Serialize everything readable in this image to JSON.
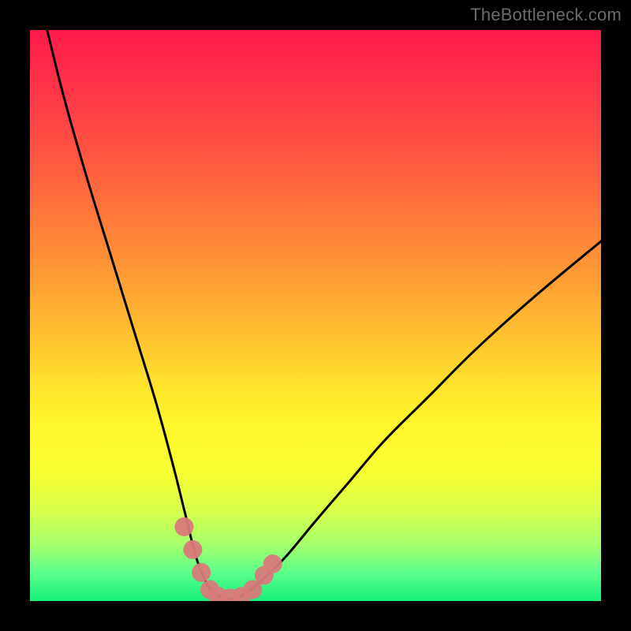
{
  "watermark": "TheBottleneck.com",
  "colors": {
    "background": "#000000",
    "gradient_top": "#ff1a4b",
    "gradient_bottom": "#18f07a",
    "curve": "#000000",
    "marker": "#d87a7a"
  },
  "chart_data": {
    "type": "line",
    "title": "",
    "xlabel": "",
    "ylabel": "",
    "xlim": [
      0,
      100
    ],
    "ylim": [
      0,
      100
    ],
    "grid": false,
    "legend": false,
    "series": [
      {
        "name": "bottleneck-curve",
        "x": [
          3,
          6,
          10,
          14,
          18,
          22,
          25,
          27,
          29,
          30.5,
          32,
          34,
          36,
          38,
          41,
          45,
          50,
          56,
          62,
          70,
          78,
          88,
          100
        ],
        "y": [
          100,
          88,
          74,
          61,
          48,
          35,
          24,
          16,
          8,
          4,
          1.5,
          0.5,
          0.5,
          1.5,
          4,
          8,
          14,
          21,
          28,
          36,
          44,
          53,
          63
        ]
      }
    ],
    "markers": [
      {
        "name": "left-cluster-1",
        "x": 27.0,
        "y": 13.0
      },
      {
        "name": "left-cluster-2",
        "x": 28.5,
        "y": 9.0
      },
      {
        "name": "left-cluster-3",
        "x": 30.0,
        "y": 5.0
      },
      {
        "name": "bottom-1",
        "x": 31.5,
        "y": 2.0
      },
      {
        "name": "bottom-2",
        "x": 33.0,
        "y": 0.8
      },
      {
        "name": "bottom-3",
        "x": 35.0,
        "y": 0.5
      },
      {
        "name": "bottom-4",
        "x": 37.0,
        "y": 0.8
      },
      {
        "name": "bottom-5",
        "x": 39.0,
        "y": 2.0
      },
      {
        "name": "right-cluster-1",
        "x": 41.0,
        "y": 4.5
      },
      {
        "name": "right-cluster-2",
        "x": 42.5,
        "y": 6.5
      }
    ]
  }
}
